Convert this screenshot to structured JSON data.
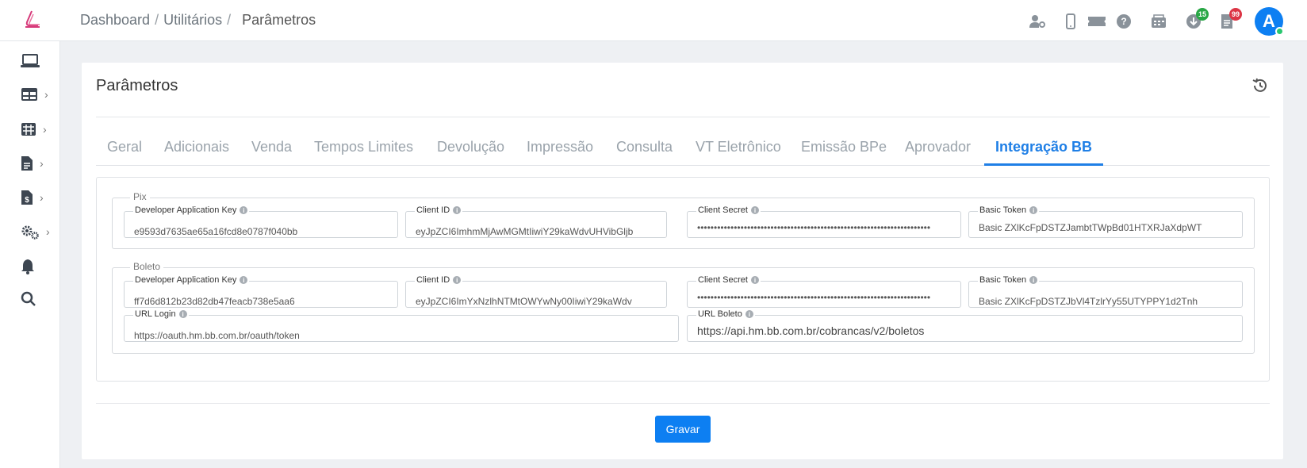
{
  "breadcrumb": {
    "items": [
      "Dashboard",
      "Utilitários"
    ],
    "current": "Parâmetros",
    "sep": "/"
  },
  "top_icons": [
    {
      "name": "user-key-icon"
    },
    {
      "name": "mobile-icon"
    },
    {
      "name": "ticket-icon"
    },
    {
      "name": "help-icon"
    },
    {
      "name": "fax-icon"
    },
    {
      "name": "download-icon",
      "badge": "15",
      "badge_color": "#28a745"
    },
    {
      "name": "document-icon",
      "badge": "99",
      "badge_color": "#dc3545"
    }
  ],
  "avatar": {
    "letter": "A"
  },
  "page": {
    "title": "Parâmetros"
  },
  "tabs": [
    {
      "label": "Geral"
    },
    {
      "label": "Adicionais"
    },
    {
      "label": "Venda"
    },
    {
      "label": "Tempos Limites"
    },
    {
      "label": "Devolução"
    },
    {
      "label": "Impressão"
    },
    {
      "label": "Consulta"
    },
    {
      "label": "VT Eletrônico"
    },
    {
      "label": "Emissão BPe"
    },
    {
      "label": "Aprovador"
    },
    {
      "label": "Integração BB",
      "active": true
    }
  ],
  "pix": {
    "title": "Pix",
    "dev_key": {
      "label": "Developer Application Key",
      "value": "e9593d7635ae65a16fcd8e0787f040bb"
    },
    "client_id": {
      "label": "Client ID",
      "value": "eyJpZCI6ImhmMjAwMGMtIiwiY29kaWdvUHVibGljb"
    },
    "client_secret": {
      "label": "Client Secret",
      "value": "••••••••••••••••••••••••••••••••••••••••••••••••••••••••••••••••••••••"
    },
    "basic_token": {
      "label": "Basic Token",
      "value": "Basic ZXlKcFpDSTZJambtTWpBd01HTXRJaXdpWT"
    }
  },
  "boleto": {
    "title": "Boleto",
    "dev_key": {
      "label": "Developer Application Key",
      "value": "ff7d6d812b23d82db47feacb738e5aa6"
    },
    "client_id": {
      "label": "Client ID",
      "value": "eyJpZCI6ImYxNzlhNTMtOWYwNy00IiwiY29kaWdv"
    },
    "client_secret": {
      "label": "Client Secret",
      "value": "••••••••••••••••••••••••••••••••••••••••••••••••••••••••••••••••••••••"
    },
    "basic_token": {
      "label": "Basic Token",
      "value": "Basic ZXlKcFpDSTZJbVl4TzlrYy55UTYPPY1d2Tnh"
    },
    "url_login": {
      "label": "URL Login",
      "value": "https://oauth.hm.bb.com.br/oauth/token"
    },
    "url_boleto": {
      "label": "URL Boleto",
      "value": "https://api.hm.bb.com.br/cobrancas/v2/boletos"
    }
  },
  "actions": {
    "save_label": "Gravar"
  },
  "colors": {
    "accent": "#0d7ff2",
    "tab_active": "#1f7fe6",
    "logo": "#d63a7a"
  }
}
